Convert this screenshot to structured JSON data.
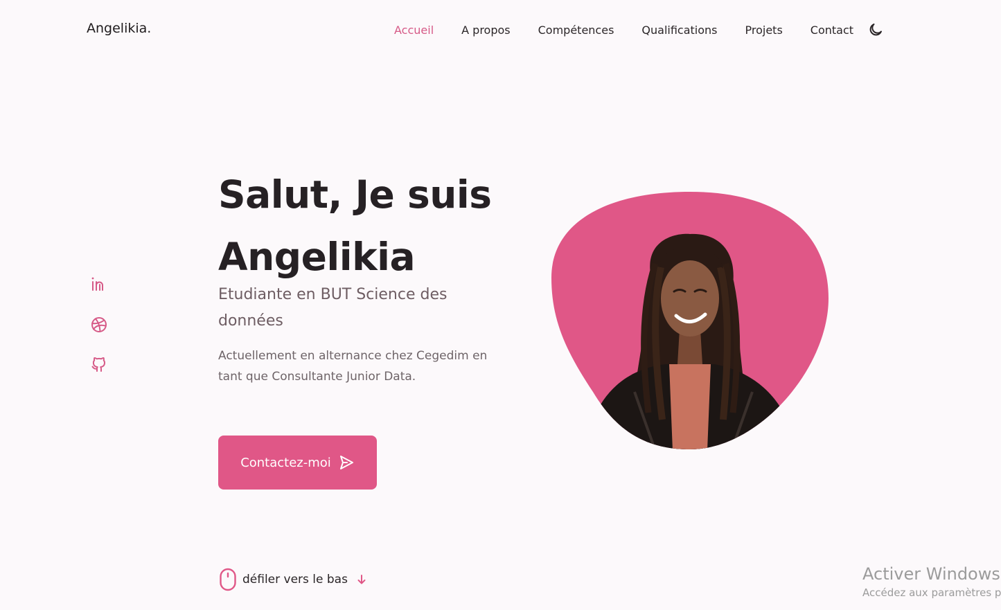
{
  "header": {
    "logo": "Angelikia.",
    "nav": [
      {
        "label": "Accueil",
        "active": true
      },
      {
        "label": "A propos",
        "active": false
      },
      {
        "label": "Compétences",
        "active": false
      },
      {
        "label": "Qualifications",
        "active": false
      },
      {
        "label": "Projets",
        "active": false
      },
      {
        "label": "Contact",
        "active": false
      }
    ],
    "theme_toggle_icon": "moon-icon"
  },
  "socials": [
    {
      "name": "linkedin-icon"
    },
    {
      "name": "dribbble-icon"
    },
    {
      "name": "github-icon"
    }
  ],
  "hero": {
    "title_line1": "Salut, Je suis",
    "title_line2": "Angelikia",
    "subtitle": "Etudiante en BUT Science des données",
    "description": "Actuellement en alternance chez Cegedim en tant que Consultante Junior Data.",
    "cta_label": "Contactez-moi",
    "cta_icon": "send-icon",
    "image": "profile-photo-in-pink-blob"
  },
  "scroll": {
    "label": "défiler vers le bas",
    "icon": "mouse-icon",
    "arrow_icon": "arrow-down-icon"
  },
  "windows_activation": {
    "title": "Activer Windows",
    "subtitle": "Accédez aux paramètres pour activer Windows."
  },
  "colors": {
    "accent": "#e05787",
    "background": "#fcf9fb",
    "text": "#2a2527",
    "muted": "#6e5d63"
  }
}
